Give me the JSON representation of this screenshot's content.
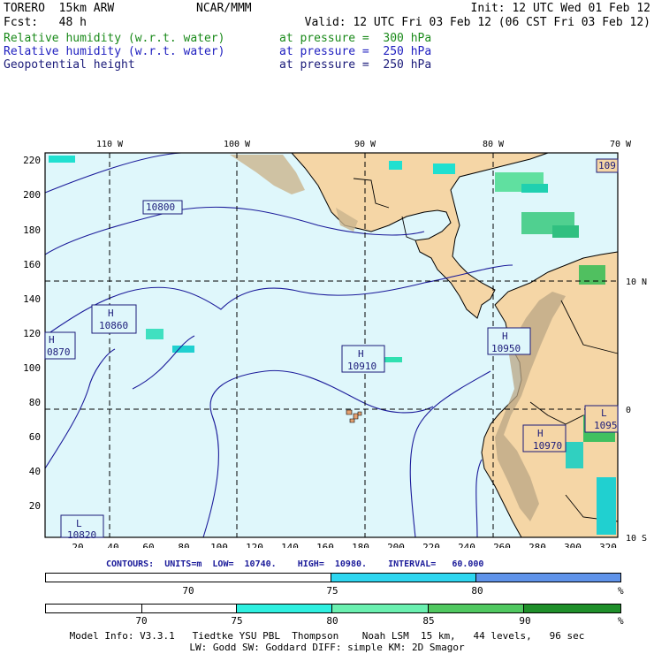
{
  "header": {
    "model": "TORERO  15km ARW",
    "org": "NCAR/MMM",
    "init": "Init: 12 UTC Wed 01 Feb 12",
    "fcst": "Fcst:   48 h",
    "valid": "Valid: 12 UTC Fri 03 Feb 12 (06 CST Fri 03 Feb 12)",
    "fields": [
      {
        "name": "Relative humidity (w.r.t. water)",
        "level": "at pressure =  300 hPa",
        "color": "#1a8a1a"
      },
      {
        "name": "Relative humidity (w.r.t. water)",
        "level": "at pressure =  250 hPa",
        "color": "#2020c0"
      },
      {
        "name": "Geopotential height",
        "level": "at pressure =  250 hPa",
        "color": "#1b1b7a"
      }
    ]
  },
  "map": {
    "lon_labels": [
      "110 W",
      "100 W",
      "90 W",
      "80 W",
      "70 W"
    ],
    "lat_labels": [
      "10 N",
      "0",
      "10 S"
    ],
    "y_ticks": [
      "220",
      "200",
      "180",
      "160",
      "140",
      "120",
      "100",
      "80",
      "60",
      "40",
      "20"
    ],
    "x_ticks": [
      "20",
      "40",
      "60",
      "80",
      "100",
      "120",
      "140",
      "160",
      "180",
      "200",
      "220",
      "240",
      "260",
      "280",
      "300",
      "320"
    ],
    "height_labels": [
      "10800",
      "10860",
      "0870",
      "10910",
      "10950",
      "10970",
      "1095",
      "109",
      "10820"
    ],
    "high_low_marks": [
      "H",
      "H",
      "H",
      "H",
      "H",
      "L",
      "L"
    ],
    "colors": {
      "ocean": "#dff7fb",
      "land": "#f5d6a6",
      "contour": "#1b1b9a",
      "rh_low": "#20e0d0",
      "rh_mid": "#60f0a0",
      "rh_high": "#40b040"
    }
  },
  "contours_line": "CONTOURS:  UNITS=m  LOW=  10740.    HIGH=  10980.    INTERVAL=   60.000",
  "colorbar1": {
    "segments": [
      {
        "from": 0,
        "to": 75,
        "color": "#ffffff"
      },
      {
        "from": 75,
        "to": 80,
        "color": "#2ed6f0"
      },
      {
        "from": 80,
        "to": 100,
        "color": "#5f93ea"
      }
    ],
    "ticks": [
      "70",
      "75",
      "80"
    ],
    "unit": "%"
  },
  "colorbar2": {
    "segments": [
      {
        "from": 60,
        "to": 75,
        "color": "#ffffff"
      },
      {
        "from": 75,
        "to": 80,
        "color": "#2ef0e0"
      },
      {
        "from": 80,
        "to": 85,
        "color": "#6af0b0"
      },
      {
        "from": 85,
        "to": 90,
        "color": "#50c860"
      },
      {
        "from": 90,
        "to": 100,
        "color": "#1f8f2a"
      }
    ],
    "ticks": [
      "70",
      "75",
      "80",
      "85",
      "90"
    ],
    "unit": "%"
  },
  "footer": {
    "line1": "Model Info: V3.3.1   Tiedtke YSU PBL  Thompson    Noah LSM  15 km,   44 levels,   96 sec",
    "line2": "LW: Godd SW: Goddard DIFF: simple KM: 2D Smagor"
  }
}
